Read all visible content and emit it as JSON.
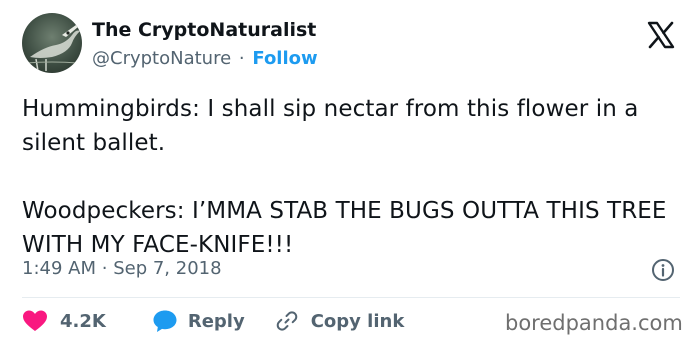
{
  "author": {
    "display_name": "The CryptoNaturalist",
    "handle": "@CryptoNature",
    "separator": "·",
    "follow_label": "Follow",
    "avatar_icon": "heron-avatar-icon"
  },
  "brand": {
    "logo_icon": "x-logo-icon"
  },
  "tweet": {
    "paragraphs": [
      "Hummingbirds: I shall sip nectar from this flower in a silent ballet.",
      "Woodpeckers: I’MMA STAB THE BUGS OUTTA THIS TREE WITH MY FACE-KNIFE!!!"
    ],
    "time": "1:49 AM",
    "separator": "·",
    "date": "Sep 7, 2018"
  },
  "actions": {
    "like_count": "4.2K",
    "reply_label": "Reply",
    "copy_link_label": "Copy link"
  },
  "watermark": "boredpanda.com",
  "colors": {
    "accent": "#1d9bf0",
    "like": "#f91880",
    "text": "#0f1419",
    "muted": "#536471"
  }
}
